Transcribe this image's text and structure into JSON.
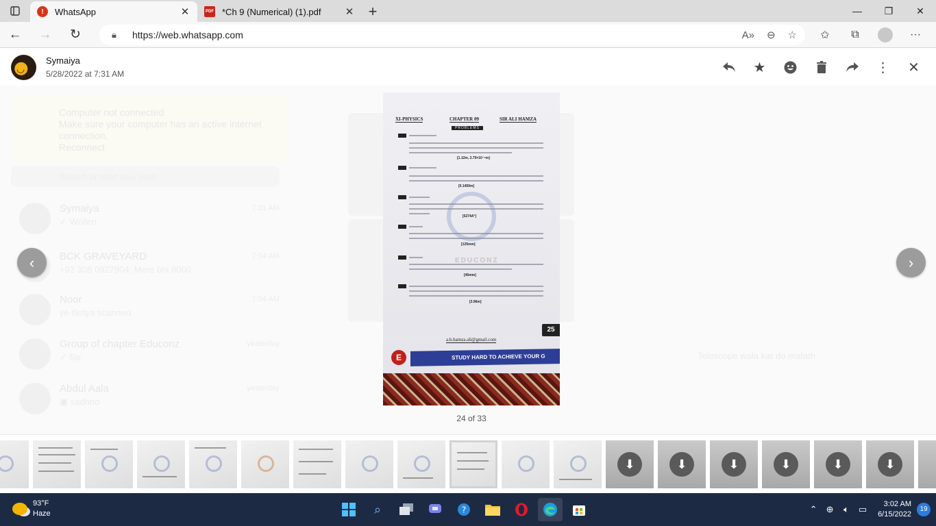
{
  "browser": {
    "tabs": [
      {
        "title": "WhatsApp",
        "icon": "whatsapp-alert-icon",
        "active": true
      },
      {
        "title": "*Ch 9 (Numerical) (1).pdf",
        "icon": "pdf-icon",
        "active": false
      }
    ],
    "url": "https://web.whatsapp.com"
  },
  "background": {
    "banner_title": "Computer not connected",
    "banner_text": "Make sure your computer has an active internet connection.",
    "banner_link": "Reconnect",
    "search_placeholder": "Search or start new chat",
    "chats": [
      {
        "name": "Symaiya",
        "message": "✓ Wollen",
        "time": "7:31 AM"
      },
      {
        "name": "BCK GRAVEYARD",
        "message": "+92 308 0927904: Mere bhi 8000",
        "time": "7:04 AM"
      },
      {
        "name": "Noor",
        "message": "ye tiknya scanned",
        "time": "7:04 AM"
      },
      {
        "name": "Group of chapter Educonz",
        "message": "✓ file",
        "time": "yesterday"
      },
      {
        "name": "Abdul Aala",
        "message": "▣ sadhno",
        "time": "yesterday"
      }
    ],
    "message_text": "Telescope wala kar do mafath"
  },
  "viewer": {
    "sender": "Symaiya",
    "timestamp": "5/28/2022 at 7:31 AM",
    "counter": "24 of 33"
  },
  "document": {
    "header_left": "XI-PHYSICS",
    "header_mid": "CHAPTER 09",
    "header_right": "SIR ALI HAMZA",
    "problems_label": "PROBLEMS",
    "answers": [
      "[1.12m, 2.79×10⁻⁶m]",
      "[0.1459m]",
      "[5274A°]",
      "[125mm]",
      "[46mm]",
      "[3.96m]"
    ],
    "email": "a.h.hamza.ali@gmail.com",
    "page_number": "25",
    "banner_text": "STUDY HARD TO ACHIEVE YOUR G"
  },
  "taskbar": {
    "temperature": "93°F",
    "condition": "Haze",
    "time": "3:02 AM",
    "date": "6/15/2022",
    "notifications": "19"
  }
}
